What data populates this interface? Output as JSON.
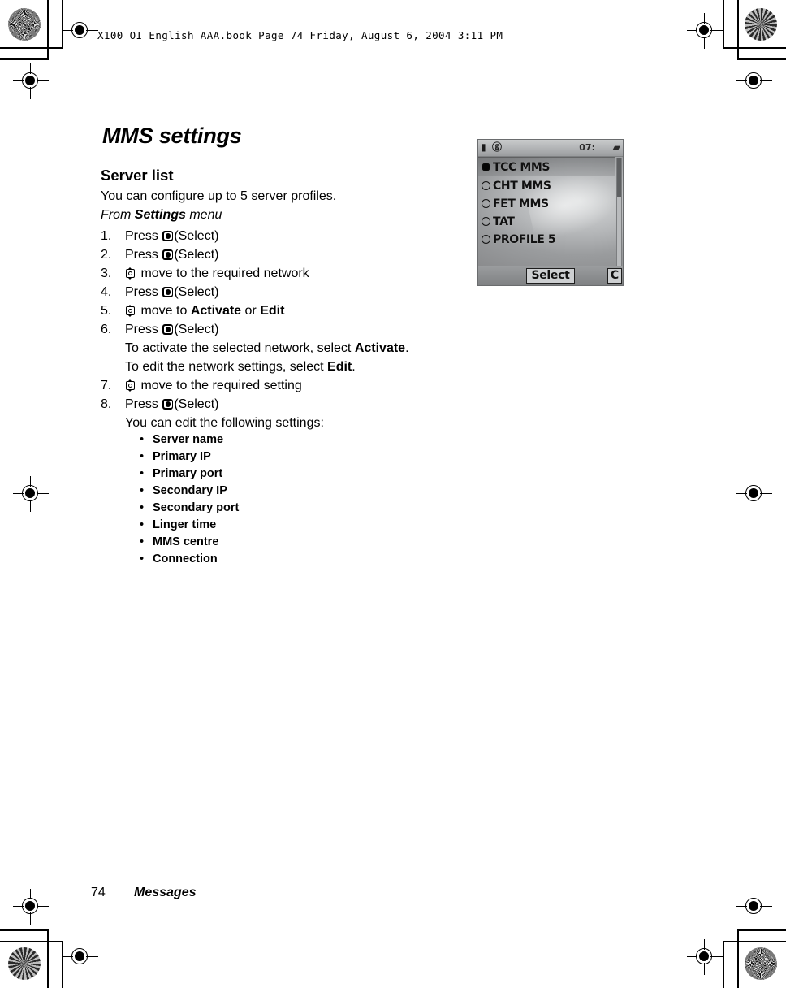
{
  "page_header": "X100_OI_English_AAA.book  Page 74  Friday, August 6, 2004  3:11 PM",
  "document": {
    "title": "MMS settings",
    "subtitle": "Server list",
    "intro": "You can configure up to 5 server profiles.",
    "from_prefix": "From ",
    "from_bold": "Settings",
    "from_suffix": " menu",
    "steps": [
      {
        "num": "1.",
        "pre": "Press ",
        "icon": "select-key-icon",
        "post": "(Select)",
        "bold": "",
        "tail": ""
      },
      {
        "num": "2.",
        "pre": "Press ",
        "icon": "select-key-icon",
        "post": "(Select)",
        "bold": "",
        "tail": ""
      },
      {
        "num": "3.",
        "pre": "",
        "icon": "navigation-key-icon",
        "post": " move to the required network",
        "bold": "",
        "tail": ""
      },
      {
        "num": "4.",
        "pre": "Press ",
        "icon": "select-key-icon",
        "post": "(Select)",
        "bold": "",
        "tail": ""
      },
      {
        "num": "5.",
        "pre": "",
        "icon": "navigation-key-icon",
        "post": " move to ",
        "bold": "Activate",
        "mid": " or ",
        "bold2": "Edit",
        "tail": ""
      },
      {
        "num": "6.",
        "pre": "Press ",
        "icon": "select-key-icon",
        "post": "(Select)",
        "bold": "",
        "tail": ""
      }
    ],
    "substeps_after_6": [
      {
        "pre": "To activate the selected network, select ",
        "bold": "Activate",
        "post": "."
      },
      {
        "pre": "To edit the network settings, select ",
        "bold": "Edit",
        "post": "."
      }
    ],
    "steps_cont": [
      {
        "num": "7.",
        "pre": "",
        "icon": "navigation-key-icon",
        "post": " move to the required setting"
      },
      {
        "num": "8.",
        "pre": "Press ",
        "icon": "select-key-icon",
        "post": "(Select)"
      }
    ],
    "substep_after_8": "You can edit the following settings:",
    "bullet_marker": "•",
    "settings_list": [
      "Server name",
      "Primary IP",
      "Primary port",
      "Secondary IP",
      "Secondary port",
      "Linger time",
      "MMS centre",
      "Connection"
    ]
  },
  "phone_screenshot": {
    "status": {
      "signal_icon": "signal-strength-icon",
      "network_icon": "network-icon",
      "time": "07:",
      "battery_icon": "battery-icon"
    },
    "list": [
      {
        "label": "TCC MMS",
        "selected": true
      },
      {
        "label": "CHT MMS",
        "selected": false
      },
      {
        "label": "FET MMS",
        "selected": false
      },
      {
        "label": "TAT",
        "selected": false
      },
      {
        "label": "PROFILE 5",
        "selected": false
      }
    ],
    "softkey_center": "Select",
    "softkey_right": "C"
  },
  "footer": {
    "page_number": "74",
    "section": "Messages"
  },
  "colors": {
    "page_background": "#ffffff",
    "text": "#000000",
    "screen_background": "#9a9c9e"
  }
}
